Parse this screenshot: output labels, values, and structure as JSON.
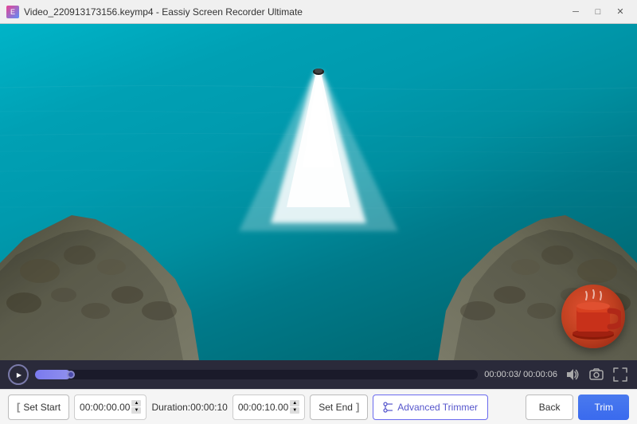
{
  "window": {
    "title": "Video_220913173156.keymp4  -  Eassiy Screen Recorder Ultimate",
    "icon": "E"
  },
  "titlebar": {
    "minimize_label": "─",
    "maximize_label": "□",
    "close_label": "✕"
  },
  "controls": {
    "current_time": "00:00:03",
    "total_time": "00:00:06",
    "time_display": "00:00:03/ 00:00:06",
    "progress_percent": 8
  },
  "bottom_bar": {
    "set_start_label": "Set Start",
    "start_time": "00:00:00.00",
    "duration_label": "Duration:00:00:10",
    "end_time": "00:00:10.00",
    "set_end_label": "Set End",
    "advanced_label": "Advanced Trimmer",
    "back_label": "Back",
    "trim_label": "Trim"
  }
}
